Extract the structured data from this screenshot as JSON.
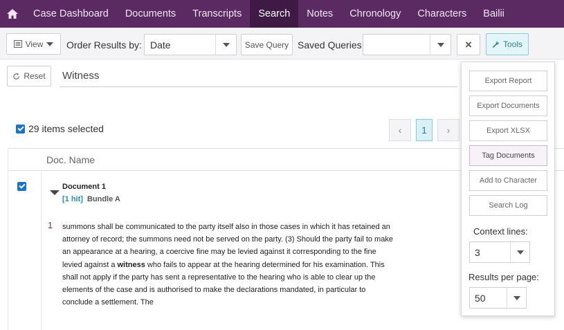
{
  "nav": {
    "items": [
      {
        "label": "Case Dashboard"
      },
      {
        "label": "Documents"
      },
      {
        "label": "Transcripts"
      },
      {
        "label": "Search"
      },
      {
        "label": "Notes"
      },
      {
        "label": "Chronology"
      },
      {
        "label": "Characters"
      },
      {
        "label": "Bailii"
      }
    ],
    "active": "Search"
  },
  "toolbar": {
    "view_label": "View",
    "order_label": "Order Results by:",
    "order_value": "Date",
    "save_query_label": "Save Query",
    "saved_queries_label": "Saved Queries:",
    "saved_queries_value": "",
    "clear_label": "×",
    "tools_label": "Tools"
  },
  "search": {
    "reset_label": "Reset",
    "term": "Witness"
  },
  "selection": {
    "text": "29 items selected"
  },
  "pager": {
    "prev": "‹",
    "current": "1",
    "next": "›"
  },
  "table": {
    "header_doc_name": "Doc. Name",
    "rows": [
      {
        "title": "Document 1",
        "hits": "[1 hit]",
        "bundle": "Bundle A",
        "line_number": "1",
        "snippet": {
          "before": "summons shall be communicated to the party itself also in those cases in which it has retained an attorney of record; the summons need not be served on the party. (3) Should the party fail to make an appearance at a hearing, a coercive fine may be levied against it corresponding to the fine levied against a ",
          "highlight": "witness",
          "after": " who fails to appear at the hearing determined for his examination. This shall not apply if the party has sent a representative to the hearing who is able to clear up the elements of the case and is authorised to make the declarations mandated, in particular to conclude a settlement. The"
        }
      }
    ]
  },
  "tools_menu": {
    "items": [
      {
        "label": "Export Report"
      },
      {
        "label": "Export Documents"
      },
      {
        "label": "Export XLSX"
      },
      {
        "label": "Tag Documents"
      },
      {
        "label": "Add to Character"
      },
      {
        "label": "Search Log"
      }
    ],
    "context_lines_label": "Context lines:",
    "context_lines_value": "3",
    "results_per_page_label": "Results per page:",
    "results_per_page_value": "50"
  },
  "colors": {
    "nav_bg": "#5b2a63",
    "nav_active": "#3f1a45",
    "accent": "#2a8fa0",
    "checkbox": "#1a73c9"
  }
}
